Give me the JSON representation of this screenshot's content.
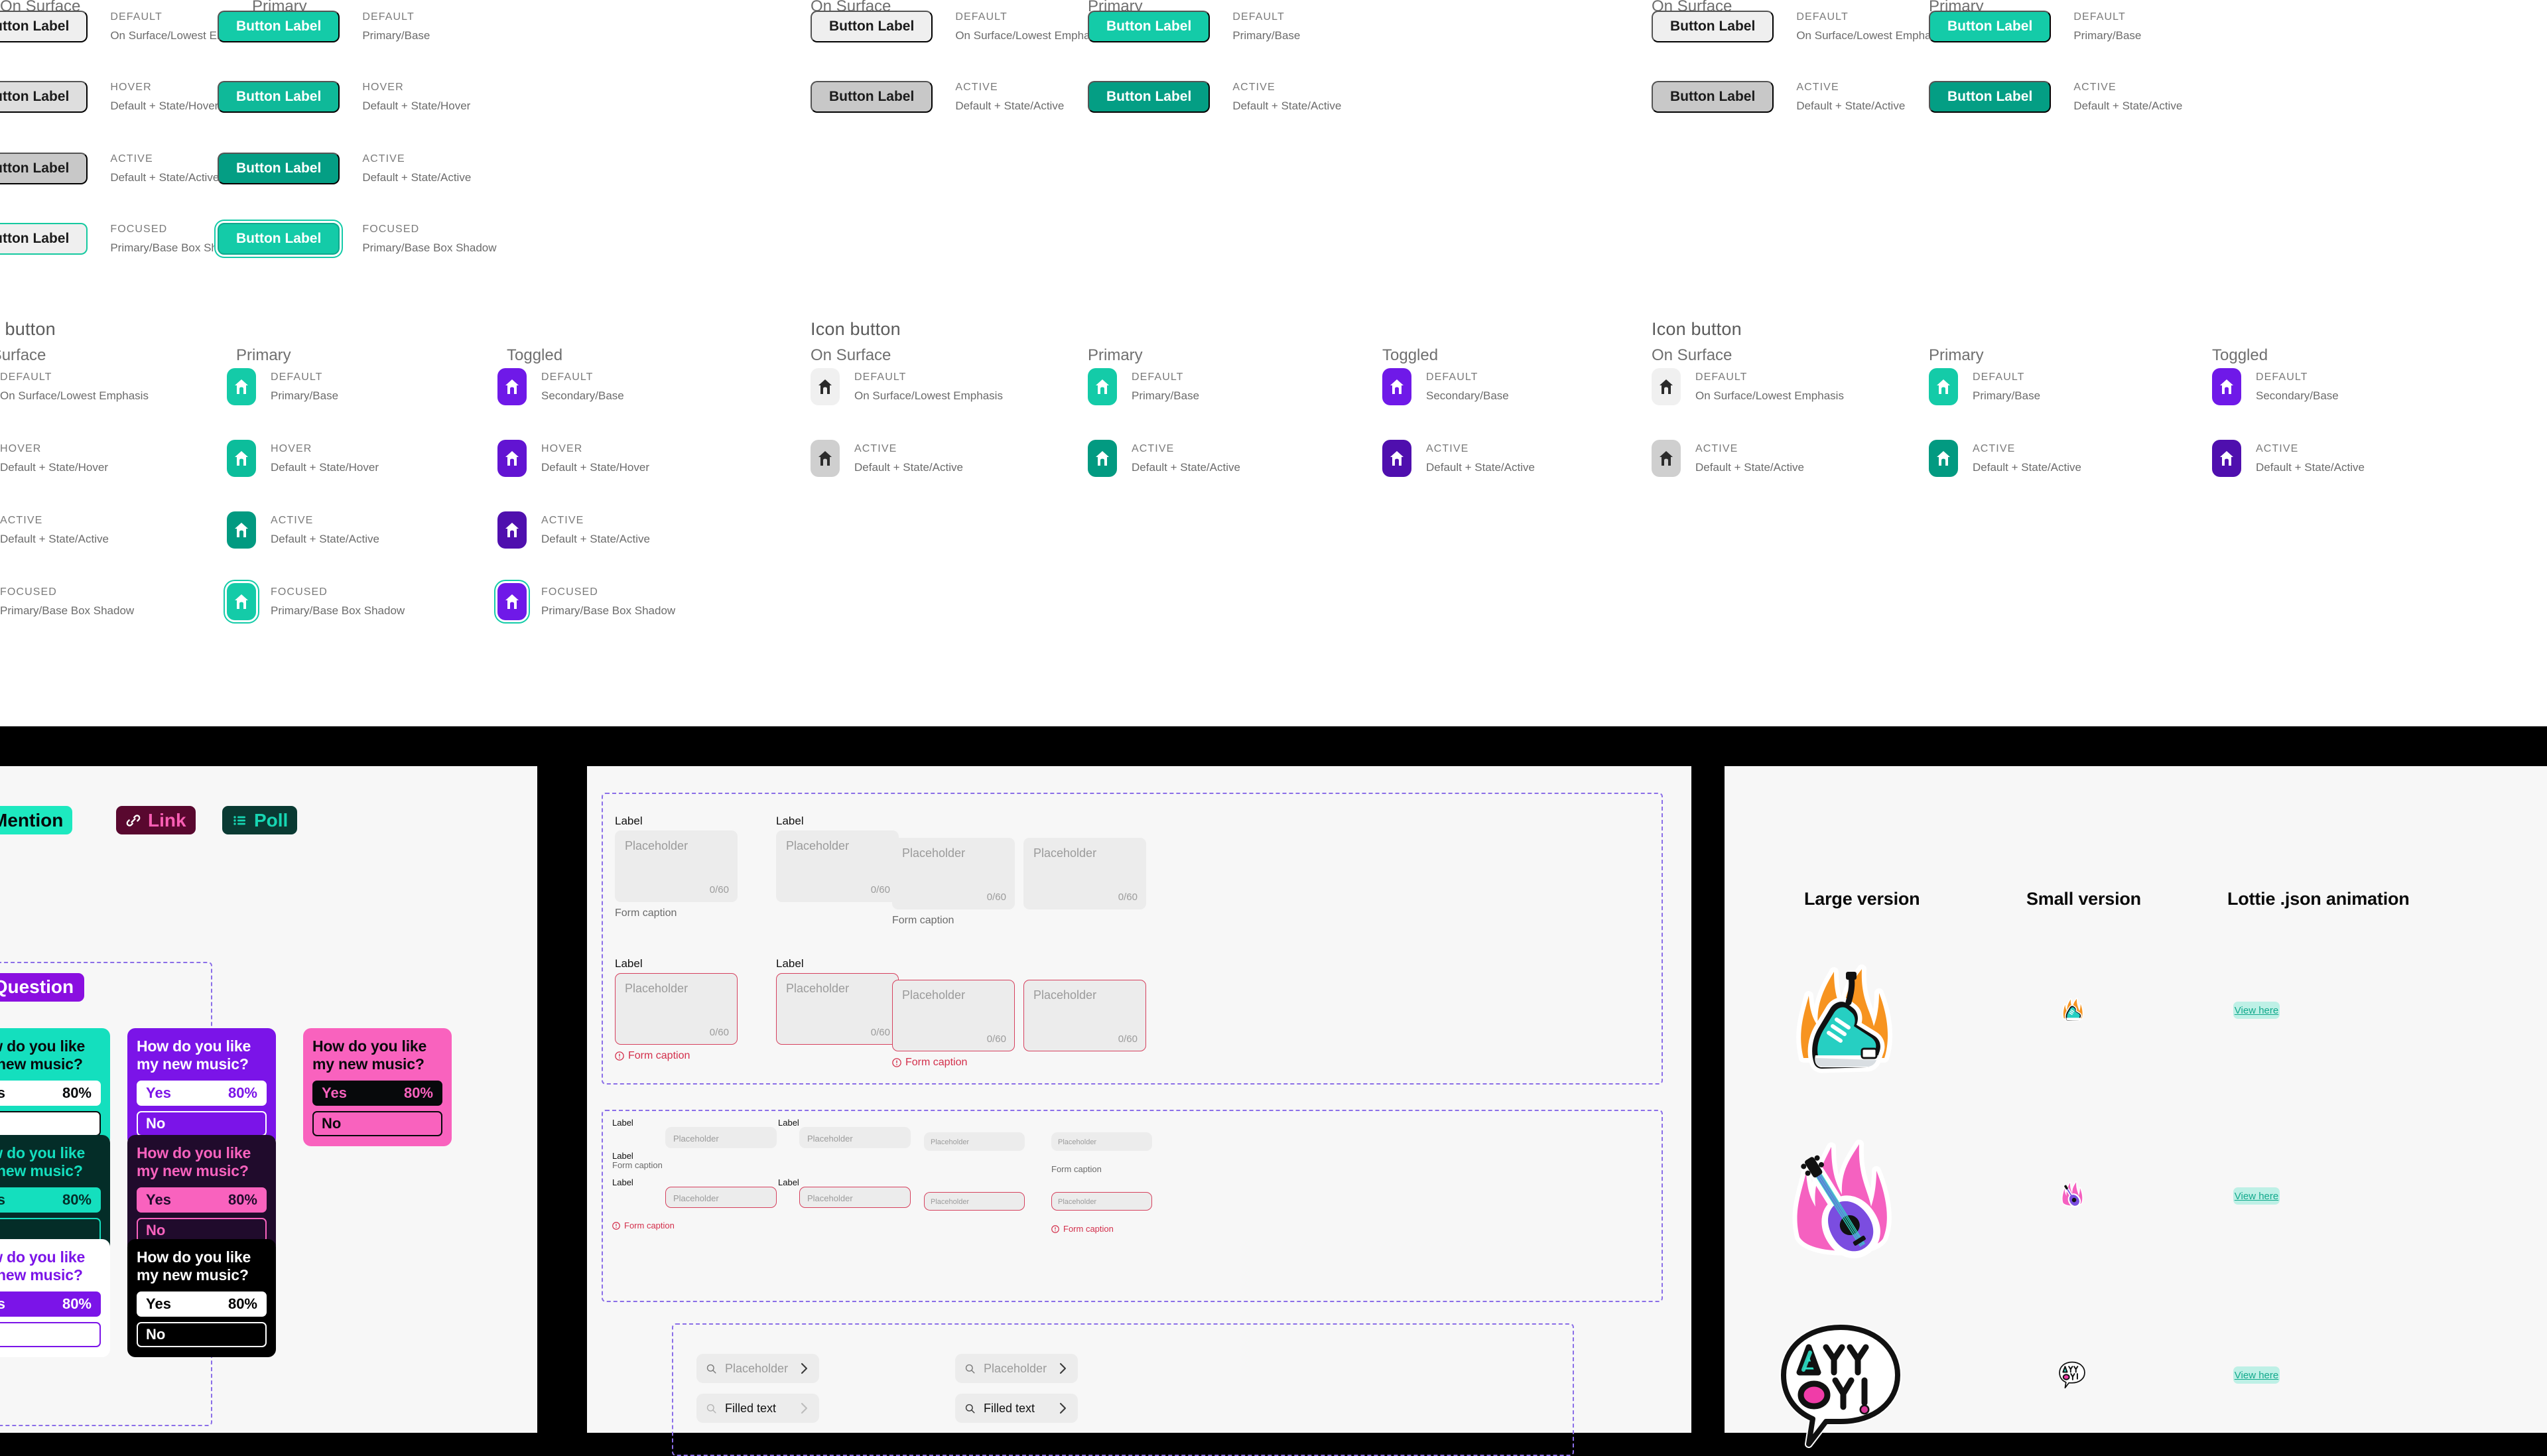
{
  "board_top": {
    "button_section": {
      "columns": [
        "On Surface",
        "Primary"
      ],
      "states": [
        {
          "state": "DEFAULT",
          "surface_token": "On Surface/Lowest Emphasis",
          "primary_token": "Primary/Base"
        },
        {
          "state": "HOVER",
          "surface_token": "Default + State/Hover",
          "primary_token": "Default + State/Hover"
        },
        {
          "state": "ACTIVE",
          "surface_token": "Default + State/Active",
          "primary_token": "Default + State/Active"
        },
        {
          "state": "FOCUSED",
          "surface_token": "Primary/Base Box Shadow",
          "primary_token": "Primary/Base Box Shadow"
        }
      ],
      "button_label": "Button Label"
    },
    "icon_button_section": {
      "title": "Icon button",
      "columns": [
        "On Surface",
        "Primary",
        "Toggled"
      ],
      "states": [
        {
          "state": "DEFAULT",
          "surface_token": "On Surface/Lowest Emphasis",
          "primary_token": "Primary/Base",
          "toggled_token": "Secondary/Base"
        },
        {
          "state": "HOVER",
          "surface_token": "Default + State/Hover",
          "primary_token": "Default + State/Hover",
          "toggled_token": "Default + State/Hover"
        },
        {
          "state": "ACTIVE",
          "surface_token": "Default + State/Active",
          "primary_token": "Default + State/Active",
          "toggled_token": "Default + State/Active"
        },
        {
          "state": "FOCUSED",
          "surface_token": "Primary/Base Box Shadow",
          "primary_token": "Primary/Base Box Shadow",
          "toggled_token": "Primary/Base Box Shadow"
        }
      ],
      "icon": "home-icon"
    },
    "colors": {
      "primary": "#14CBA8",
      "primary_active": "#049E84",
      "secondary": "#6F19E8",
      "surface": "#EFEFEF"
    }
  },
  "panel_chat": {
    "chips": [
      {
        "label": "Mention",
        "icon": "at-icon",
        "bg": "#1DE9C0",
        "fg": "#05070A"
      },
      {
        "label": "Link",
        "icon": "link-icon",
        "bg": "#59082F",
        "fg": "#FB5FB5"
      },
      {
        "label": "Poll",
        "icon": "list-icon",
        "bg": "#0A3A33",
        "fg": "#17D6B3"
      }
    ],
    "question_badge": {
      "mark": "?",
      "label": "Question"
    },
    "poll_question": "How do you like my new music?",
    "poll_options": [
      {
        "label": "Yes",
        "percent": "80%"
      },
      {
        "label": "No",
        "percent": ""
      }
    ],
    "poll_variants": [
      {
        "name": "teal-light",
        "card_bg": "#14DFBE",
        "title": "#07090B",
        "yes_bg": "#FFFFFF",
        "yes_fg": "#07090B",
        "yes_border": "#FFFFFF",
        "no_bg": "#FFFFFF",
        "no_fg": "#07090B",
        "no_border": "#07090B"
      },
      {
        "name": "violet-light",
        "card_bg": "#7B14E8",
        "title": "#FFFFFF",
        "yes_bg": "#FFFFFF",
        "yes_fg": "#7B14E8",
        "yes_border": "#FFFFFF",
        "no_bg": "#7B14E8",
        "no_fg": "#FFFFFF",
        "no_border": "#FFFFFF"
      },
      {
        "name": "pink-light",
        "card_bg": "#F962BE",
        "title": "#07090B",
        "yes_bg": "#07090B",
        "yes_fg": "#F962BE",
        "yes_border": "#07090B",
        "no_bg": "#F962BE",
        "no_fg": "#07090B",
        "no_border": "#07090B"
      },
      {
        "name": "teal-dark",
        "card_bg": "#042D28",
        "title": "#14DFBE",
        "yes_bg": "#14DFBE",
        "yes_fg": "#042D28",
        "yes_border": "#14DFBE",
        "no_bg": "#042D28",
        "no_fg": "#14DFBE",
        "no_border": "#14DFBE"
      },
      {
        "name": "pink-dark",
        "card_bg": "#200B2C",
        "title": "#F962BE",
        "yes_bg": "#F962BE",
        "yes_fg": "#200B2C",
        "yes_border": "#F962BE",
        "no_bg": "#200B2C",
        "no_fg": "#F962BE",
        "no_border": "#F962BE"
      },
      {
        "name": "violet-on-white",
        "card_bg": "#FFFFFF",
        "title": "#7B14E8",
        "yes_bg": "#7B14E8",
        "yes_fg": "#FFFFFF",
        "yes_border": "#7B14E8",
        "no_bg": "#FFFFFF",
        "no_fg": "#7B14E8",
        "no_border": "#7B14E8"
      },
      {
        "name": "black",
        "card_bg": "#000000",
        "title": "#FFFFFF",
        "yes_bg": "#FFFFFF",
        "yes_fg": "#000000",
        "yes_border": "#FFFFFF",
        "no_bg": "#000000",
        "no_fg": "#FFFFFF",
        "no_border": "#FFFFFF"
      }
    ]
  },
  "panel_form": {
    "label": "Label",
    "placeholder": "Placeholder",
    "counter": "0/60",
    "caption": "Form caption",
    "caption_error": "Form caption",
    "select_placeholder": "Placeholder",
    "select_value": "Filled text",
    "search_icon": "search-icon",
    "chevron_icon": "chevron-right-icon",
    "error_icon": "alert-circle-icon",
    "error_color": "#D6415E"
  },
  "panel_sticker": {
    "headers": [
      "Large version",
      "Small version",
      "Lottie .json animation"
    ],
    "rows": [
      {
        "name": "flaming-sneakers-sticker",
        "view_label": "View here"
      },
      {
        "name": "flaming-guitar-sticker",
        "view_label": "View here"
      },
      {
        "name": "ay-yo-speech-bubble-sticker",
        "view_label": "View here"
      }
    ],
    "view_button_bg": "#BEF0E6",
    "view_button_fg": "#12A98C"
  }
}
